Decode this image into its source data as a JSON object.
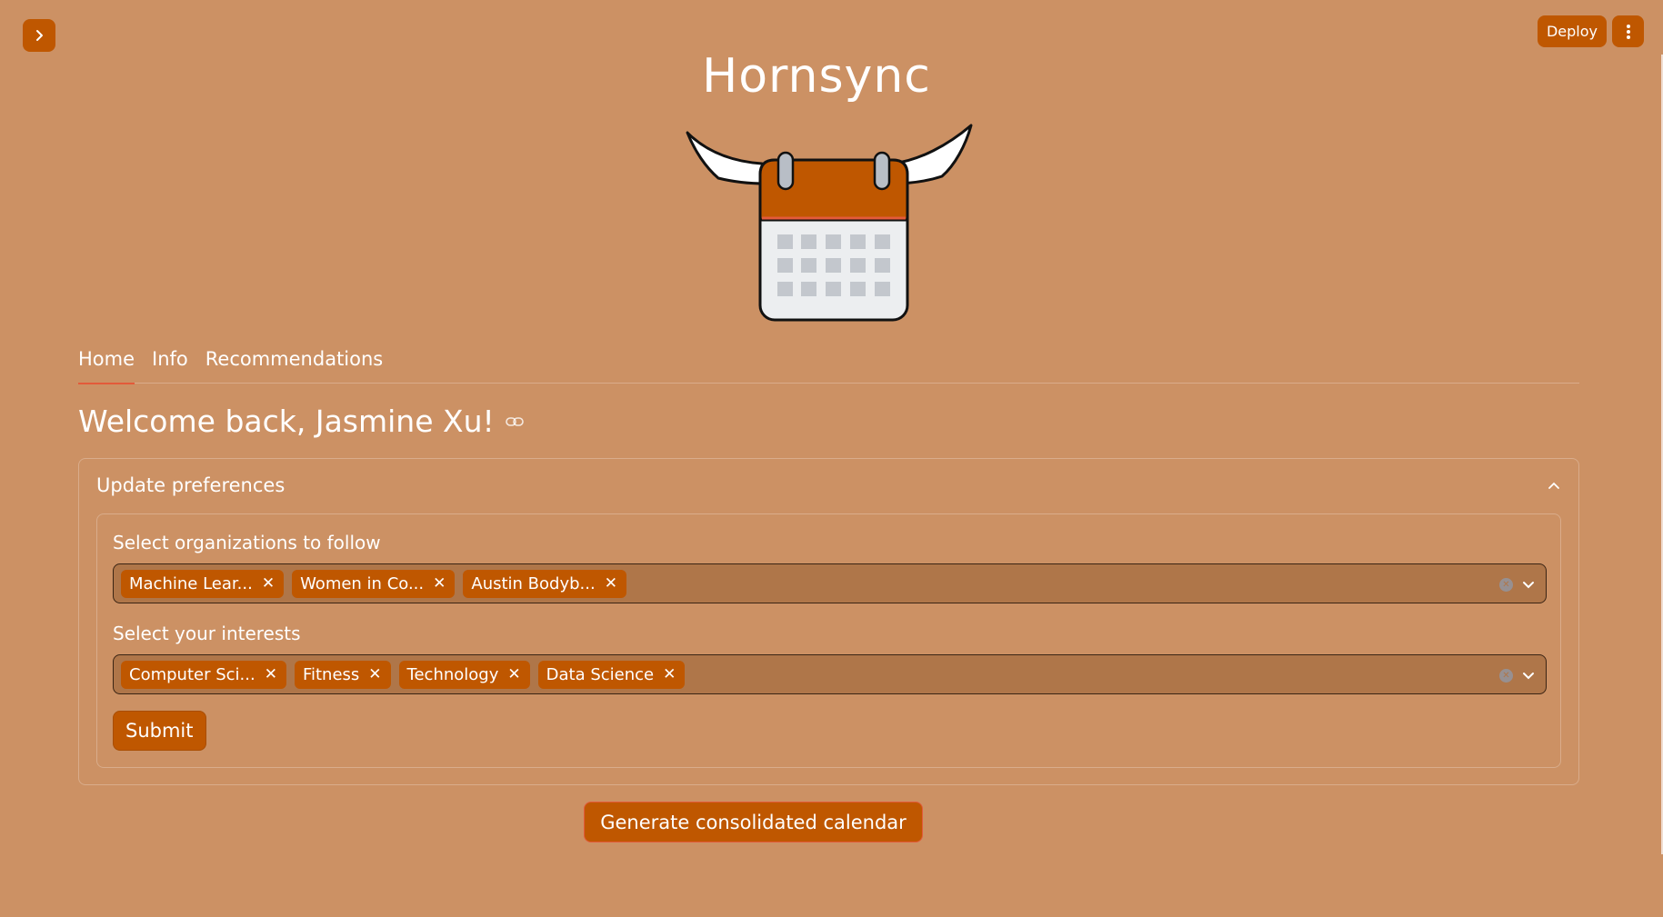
{
  "header": {
    "deploy_label": "Deploy",
    "app_title": "Hornsync"
  },
  "tabs": [
    {
      "label": "Home"
    },
    {
      "label": "Info"
    },
    {
      "label": "Recommendations"
    }
  ],
  "main": {
    "welcome": "Welcome back, Jasmine Xu!",
    "expander_title": "Update preferences",
    "orgs_label": "Select organizations to follow",
    "orgs": [
      "Machine Lear...",
      "Women in Co...",
      "Austin Bodyb..."
    ],
    "interests_label": "Select your interests",
    "interests": [
      "Computer Sci...",
      "Fitness",
      "Technology",
      "Data Science"
    ],
    "submit_label": "Submit",
    "generate_label": "Generate consolidated calendar"
  },
  "colors": {
    "background": "#CC9164",
    "accent": "#BF5700",
    "field_background": "#AF7649"
  }
}
